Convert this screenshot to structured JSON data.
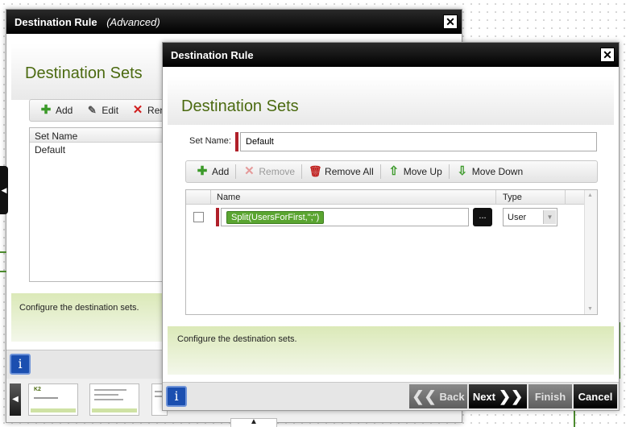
{
  "back_dialog": {
    "title": "Destination Rule",
    "subtitle": "(Advanced)",
    "heading": "Destination Sets",
    "toolbar": {
      "add": "Add",
      "edit": "Edit",
      "remove_partial": "Ren"
    },
    "list": {
      "column": "Set Name",
      "rows": [
        "Default"
      ]
    },
    "info_text": "Configure the destination sets.",
    "thumbnail_label": "K2"
  },
  "front_dialog": {
    "title": "Destination Rule",
    "heading": "Destination Sets",
    "set_name_label": "Set Name:",
    "set_name_value": "Default",
    "toolbar": {
      "add": "Add",
      "remove": "Remove",
      "remove_all": "Remove All",
      "move_up": "Move Up",
      "move_down": "Move Down"
    },
    "grid": {
      "columns": [
        "Name",
        "Type"
      ],
      "rows": [
        {
          "expression": "Split(UsersForFirst,\";\")",
          "browse": "...",
          "type": "User"
        }
      ]
    },
    "info_text": "Configure the destination sets.",
    "nav": {
      "back": "Back",
      "next": "Next",
      "finish": "Finish",
      "cancel": "Cancel"
    }
  },
  "colors": {
    "heading_green": "#4b6a10",
    "expression_green": "#5aa531",
    "required_marker": "#b0202a",
    "info_blue": "#1b4fb0"
  }
}
